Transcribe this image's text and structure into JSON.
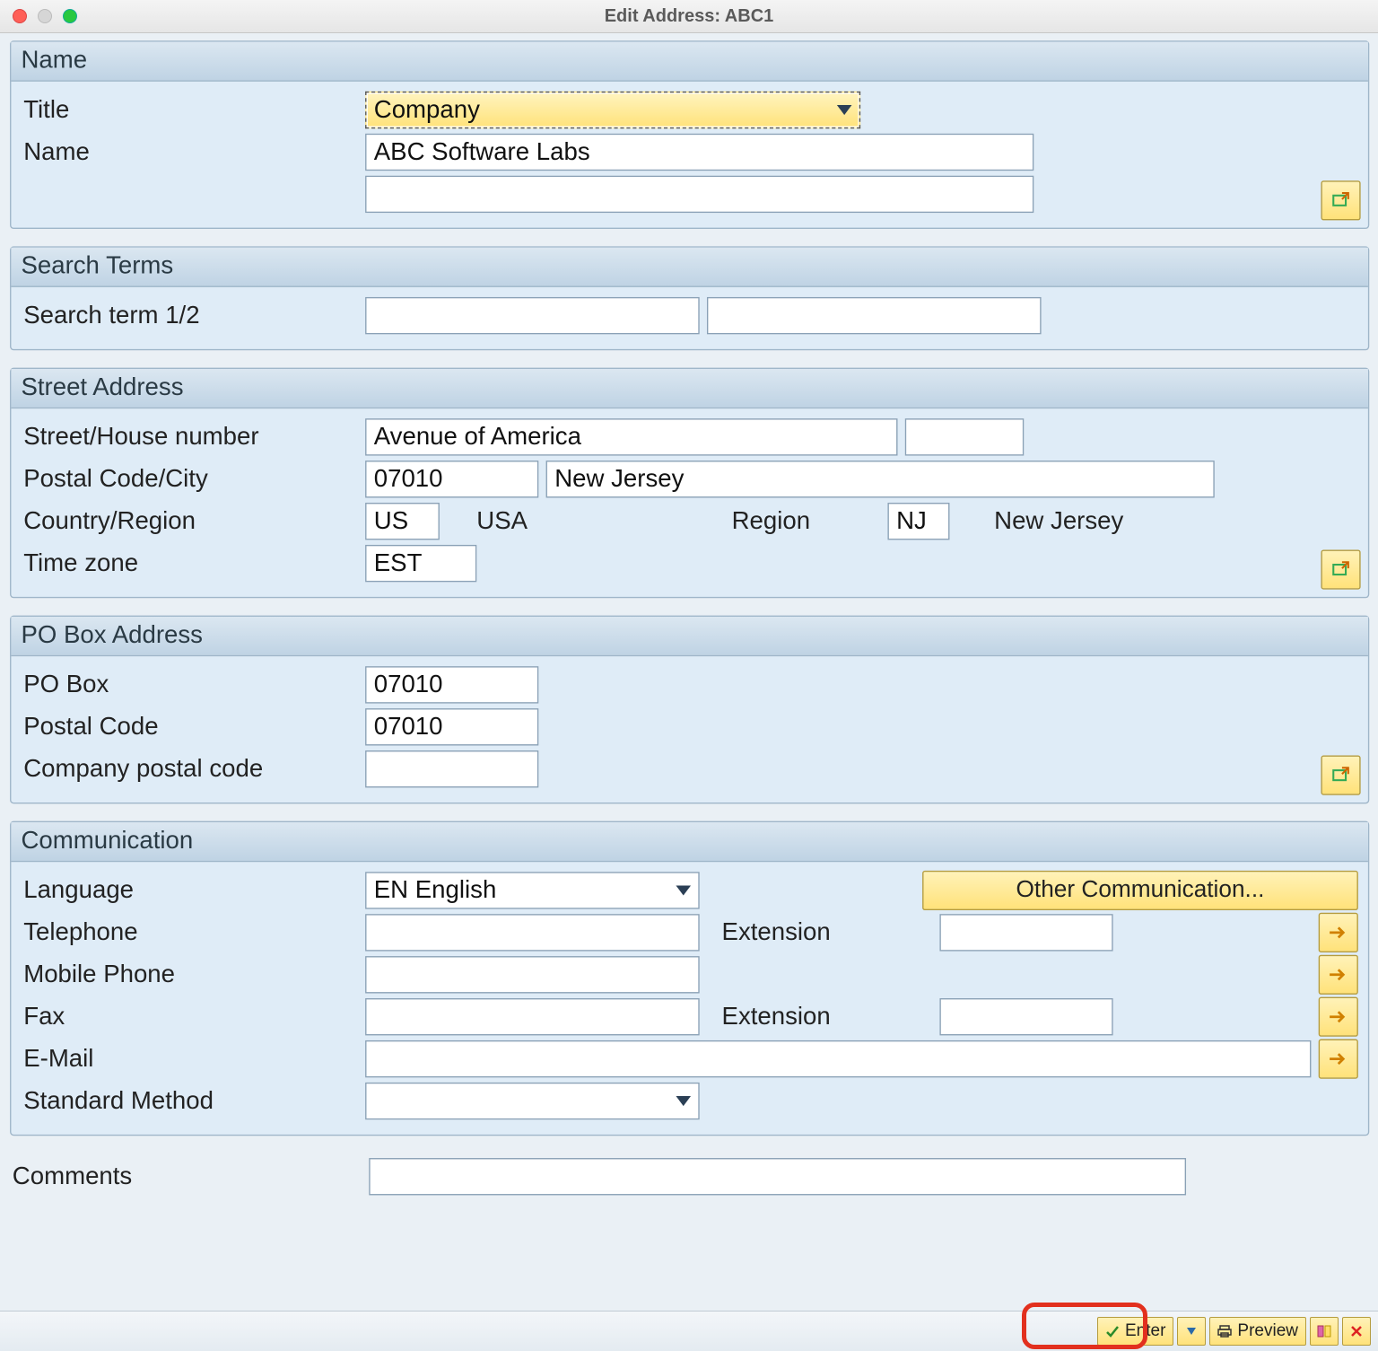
{
  "window": {
    "title": "Edit Address:  ABC1"
  },
  "groups": {
    "name": {
      "header": "Name",
      "title_label": "Title",
      "title_value": "Company",
      "name_label": "Name",
      "name_value": "ABC Software Labs",
      "name2_value": ""
    },
    "search": {
      "header": "Search Terms",
      "term_label": "Search term 1/2",
      "term1_value": "",
      "term2_value": ""
    },
    "street": {
      "header": "Street Address",
      "street_label": "Street/House number",
      "street_value": "Avenue of America",
      "house_value": "",
      "postal_label": "Postal Code/City",
      "postal_value": "07010",
      "city_value": "New Jersey",
      "country_label": "Country/Region",
      "country_value": "US",
      "country_text": "USA",
      "region_label": "Region",
      "region_value": "NJ",
      "region_text": "New Jersey",
      "tz_label": "Time zone",
      "tz_value": "EST"
    },
    "pobox": {
      "header": "PO Box Address",
      "pobox_label": "PO Box",
      "pobox_value": "07010",
      "postal_label": "Postal Code",
      "postal_value": "07010",
      "company_postal_label": "Company postal code",
      "company_postal_value": ""
    },
    "comm": {
      "header": "Communication",
      "lang_label": "Language",
      "lang_value": "EN  English",
      "other_btn": "Other Communication...",
      "tel_label": "Telephone",
      "tel_value": "",
      "ext1_label": "Extension",
      "ext1_value": "",
      "mobile_label": "Mobile Phone",
      "mobile_value": "",
      "fax_label": "Fax",
      "fax_value": "",
      "ext2_label": "Extension",
      "ext2_value": "",
      "email_label": "E-Mail",
      "email_value": "",
      "std_label": "Standard Method",
      "std_value": ""
    }
  },
  "comments": {
    "label": "Comments",
    "value": ""
  },
  "toolbar": {
    "enter": "Enter",
    "preview": "Preview"
  }
}
